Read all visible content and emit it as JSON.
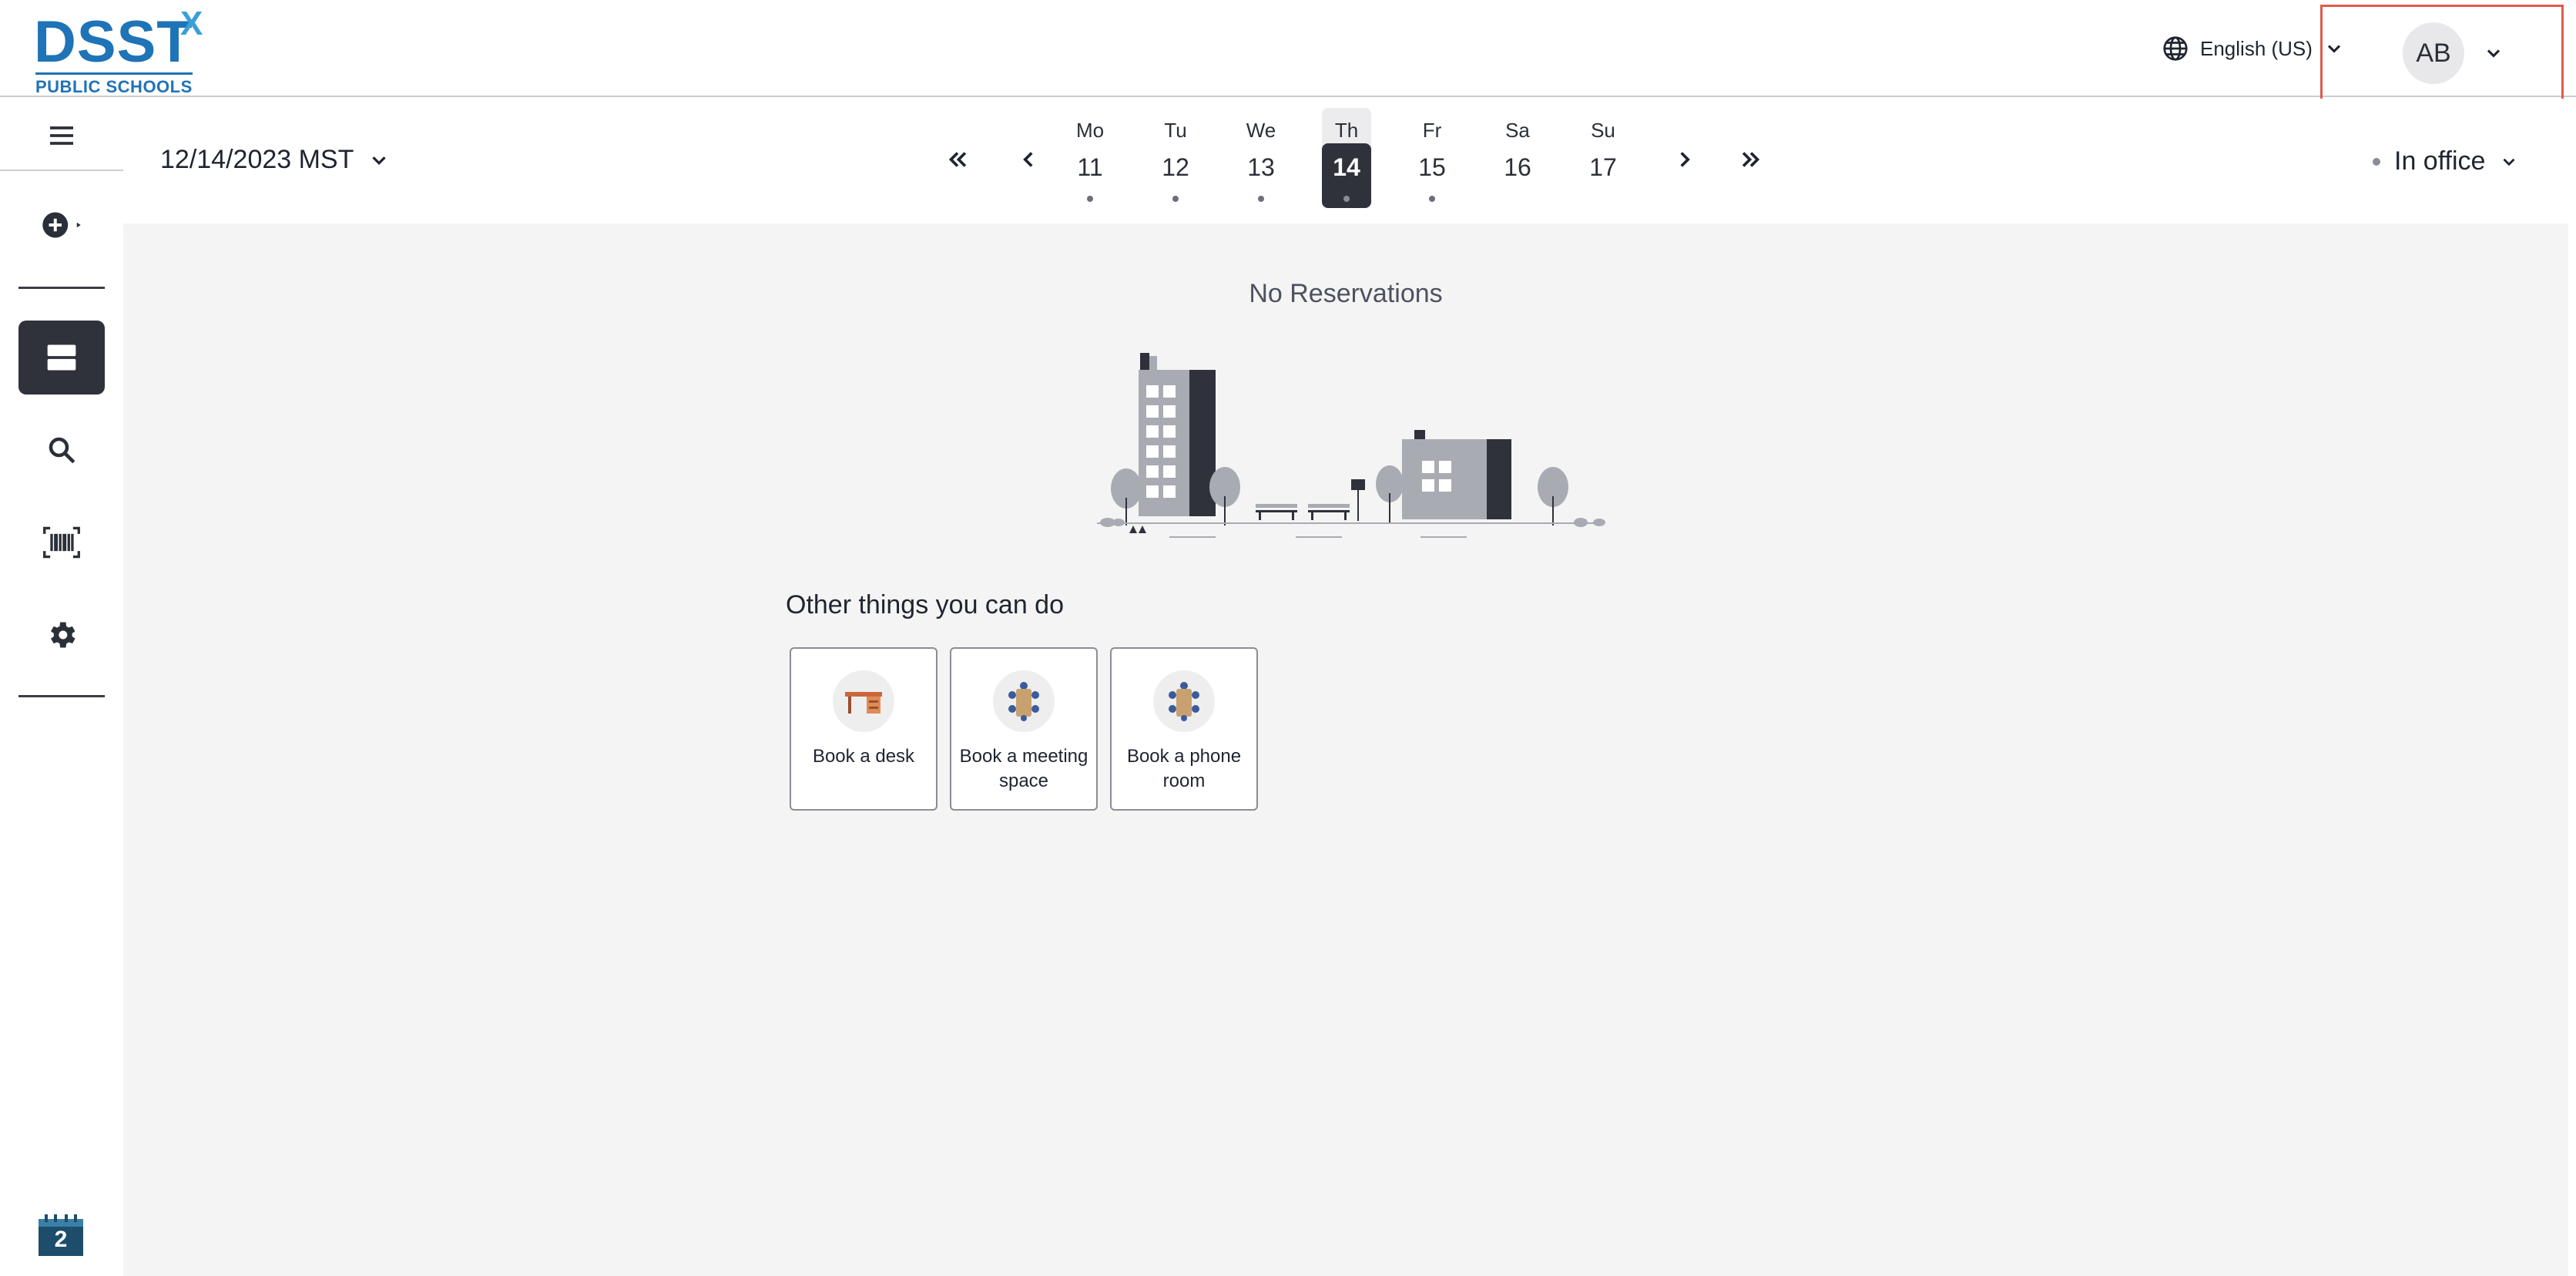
{
  "header": {
    "logo_main": "DSST",
    "logo_x": "X",
    "logo_sub": "PUBLIC SCHOOLS",
    "language": "English (US)",
    "avatar_initials": "AB"
  },
  "sidebar": {
    "items": [
      {
        "name": "menu",
        "icon": "hamburger-icon"
      },
      {
        "name": "create",
        "icon": "plus-circle-icon"
      },
      {
        "name": "reservations",
        "icon": "reservations-icon"
      },
      {
        "name": "search",
        "icon": "search-icon"
      },
      {
        "name": "scan",
        "icon": "barcode-icon"
      },
      {
        "name": "settings",
        "icon": "gear-icon"
      }
    ],
    "calendar_badge": "2"
  },
  "toolbar": {
    "date": "12/14/2023 MST",
    "days": [
      {
        "name": "Mo",
        "date": "11",
        "dot": true
      },
      {
        "name": "Tu",
        "date": "12",
        "dot": true
      },
      {
        "name": "We",
        "date": "13",
        "dot": true
      },
      {
        "name": "Th",
        "date": "14",
        "dot": true,
        "selected": true
      },
      {
        "name": "Fr",
        "date": "15",
        "dot": true
      },
      {
        "name": "Sa",
        "date": "16",
        "dot": false
      },
      {
        "name": "Su",
        "date": "17",
        "dot": false
      }
    ],
    "status": "In office"
  },
  "main": {
    "empty_text": "No Reservations",
    "other_title": "Other things you can do",
    "cards": [
      {
        "label": "Book a desk",
        "icon": "desk-icon"
      },
      {
        "label": "Book a meeting space",
        "icon": "meeting-room-icon"
      },
      {
        "label": "Book a phone room",
        "icon": "phone-room-icon"
      }
    ]
  },
  "colors": {
    "accent": "#2f323b",
    "brand": "#1f73b7",
    "highlight_box": "#e05a4a",
    "background": "#f4f4f4"
  }
}
